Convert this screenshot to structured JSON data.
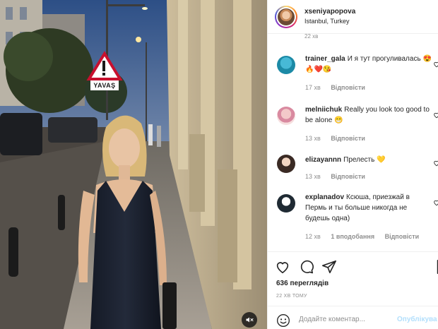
{
  "media": {
    "sign_text": "YAVAŞ",
    "mute_icon": "speaker-muted-icon"
  },
  "post": {
    "author": "xseniyapopova",
    "location": "Istanbul, Turkey",
    "cut_time": "22 хв"
  },
  "comments": [
    {
      "user": "trainer_gala",
      "text": "И я тут прогуливалась 😍🔥❤️😘",
      "time": "17 хв",
      "reply": "Відповісти"
    },
    {
      "user": "melniichuk",
      "text": "Really you look too good to be alone 😁",
      "time": "13 хв",
      "reply": "Відповісти"
    },
    {
      "user": "elizayannn",
      "text": "Прелесть 💛",
      "time": "13 хв",
      "reply": "Відповісти"
    },
    {
      "user": "explanadov",
      "text": "Ксюша, приезжай в Пермь и ты больше никогда не будешь одна)",
      "time": "12 хв",
      "likes": "1 вподобання",
      "reply": "Відповісти"
    }
  ],
  "actions": {
    "views": "636 переглядів",
    "date": "22 ХВ ТОМУ",
    "comment_placeholder": "Додайте коментар...",
    "post_label": "Опублікува"
  },
  "colors": {
    "link_disabled": "#b2dffc",
    "meta_gray": "#8e8e8e",
    "text": "#262626"
  }
}
